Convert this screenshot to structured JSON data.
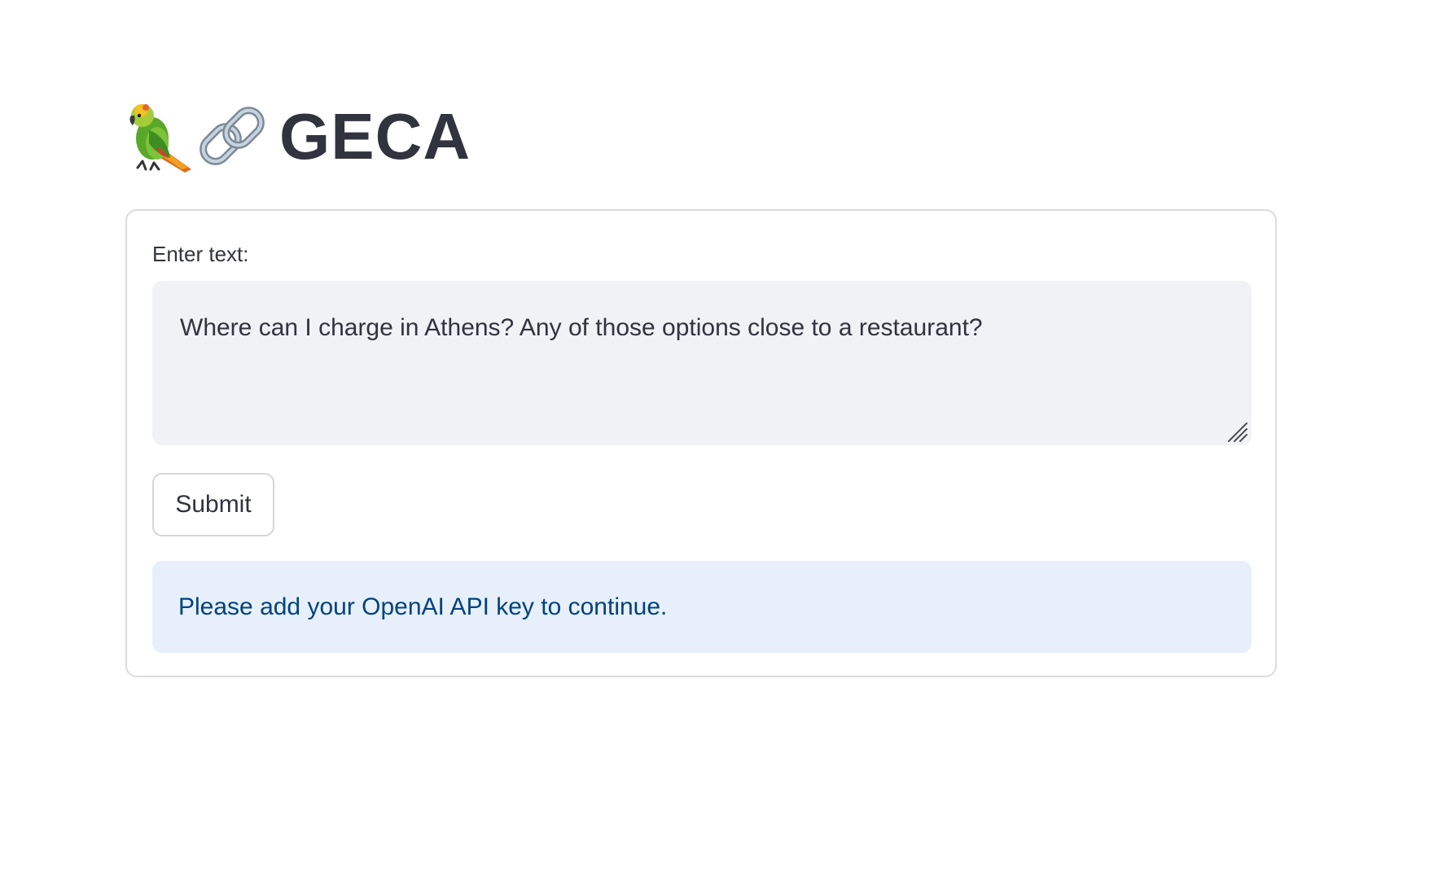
{
  "header": {
    "icons": [
      "parrot-icon",
      "link-icon"
    ],
    "title": "GECA"
  },
  "form": {
    "label": "Enter text:",
    "input_value": "Where can I charge in Athens? Any of those options close to a restaurant?",
    "submit_label": "Submit"
  },
  "alert": {
    "message": "Please add your OpenAI API key to continue."
  },
  "colors": {
    "text": "#31333f",
    "input_bg": "#f0f2f6",
    "alert_bg": "#e7f0fa",
    "alert_text": "#004280",
    "border": "#dcdcdc"
  }
}
